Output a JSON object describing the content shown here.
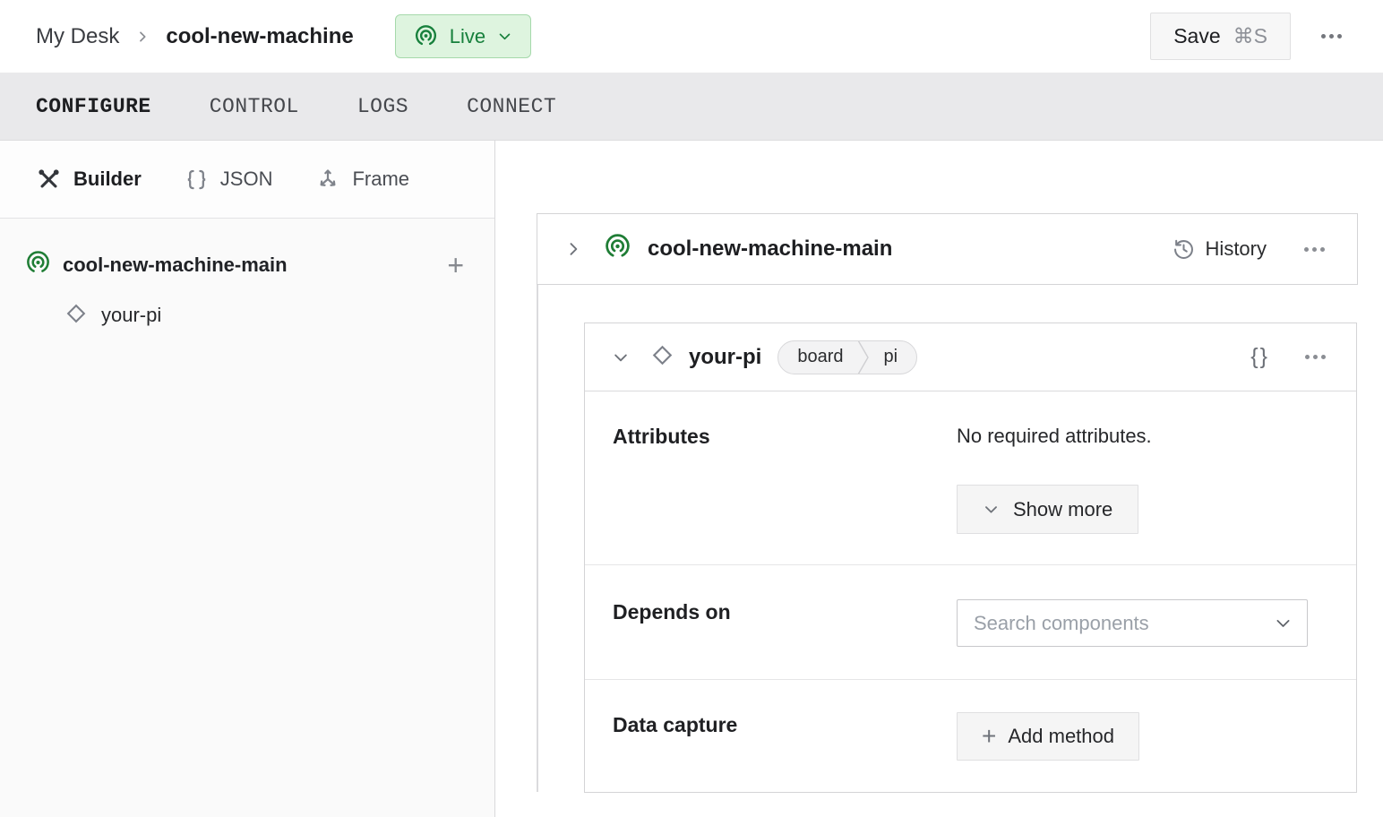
{
  "topbar": {
    "breadcrumb": {
      "parent": "My Desk",
      "current": "cool-new-machine"
    },
    "live": {
      "label": "Live"
    },
    "save": {
      "label": "Save",
      "shortcut": "⌘S"
    }
  },
  "tabs": {
    "configure": "CONFIGURE",
    "control": "CONTROL",
    "logs": "LOGS",
    "connect": "CONNECT"
  },
  "sidebar": {
    "modes": {
      "builder": "Builder",
      "json": "JSON",
      "frame": "Frame"
    },
    "tree": {
      "machine_part": "cool-new-machine-main",
      "add": "+",
      "component": "your-pi"
    }
  },
  "main": {
    "part_card": {
      "title": "cool-new-machine-main",
      "history": "History"
    },
    "component_card": {
      "title": "your-pi",
      "tags": {
        "type": "board",
        "model": "pi"
      },
      "json_toggle": "{}",
      "attributes": {
        "label": "Attributes",
        "empty": "No required attributes.",
        "show_more": "Show more"
      },
      "depends_on": {
        "label": "Depends on",
        "placeholder": "Search components"
      },
      "data_capture": {
        "label": "Data capture",
        "add_method": "Add method",
        "plus": "+"
      }
    }
  },
  "icons": {
    "live_badge": "broadcast-icon",
    "builder": "crossed-tools-icon",
    "json": "curly-braces-icon",
    "frame": "frame-axes-icon",
    "component": "diamond-icon",
    "history": "clock-history-icon",
    "menus": "three-dots-icon"
  },
  "colors": {
    "green_text": "#17803c",
    "green_icon": "#1f7d35",
    "live_bg": "#def4df",
    "live_border": "#a5d9ab",
    "tabbar_bg": "#e9e9eb",
    "card_border": "#d4d4d6"
  }
}
